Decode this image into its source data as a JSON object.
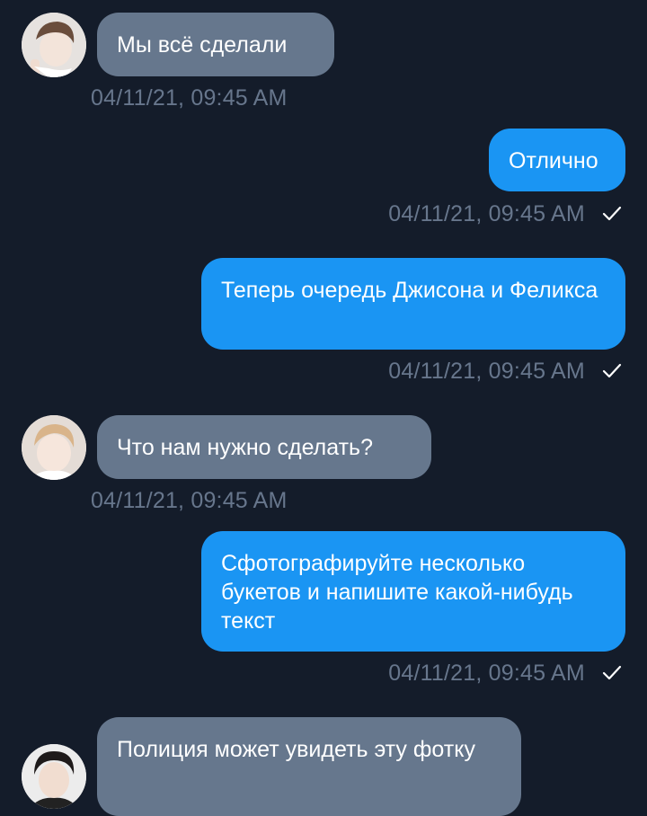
{
  "messages": [
    {
      "direction": "in",
      "avatar": "avatar-1",
      "text": "Мы всё сделали",
      "timestamp": "04/11/21, 09:45 AM"
    },
    {
      "direction": "out",
      "text": "Отлично",
      "timestamp": "04/11/21, 09:45 AM",
      "status_icon": "check-icon"
    },
    {
      "direction": "out",
      "text": "Теперь очередь Джисона и Феликса",
      "timestamp": "04/11/21, 09:45 AM",
      "status_icon": "check-icon"
    },
    {
      "direction": "in",
      "avatar": "avatar-2",
      "text": "Что нам нужно сделать?",
      "timestamp": "04/11/21, 09:45 AM"
    },
    {
      "direction": "out",
      "text": "Сфотографируйте несколько букетов и напишите какой-нибудь текст",
      "timestamp": "04/11/21, 09:45 AM",
      "status_icon": "check-icon"
    },
    {
      "direction": "in",
      "avatar": "avatar-3",
      "text": "Полиция может увидеть эту фотку"
    }
  ],
  "colors": {
    "background": "#141c2a",
    "incoming_bubble": "#66778d",
    "outgoing_bubble": "#1a95f3",
    "timestamp": "#67768c"
  }
}
